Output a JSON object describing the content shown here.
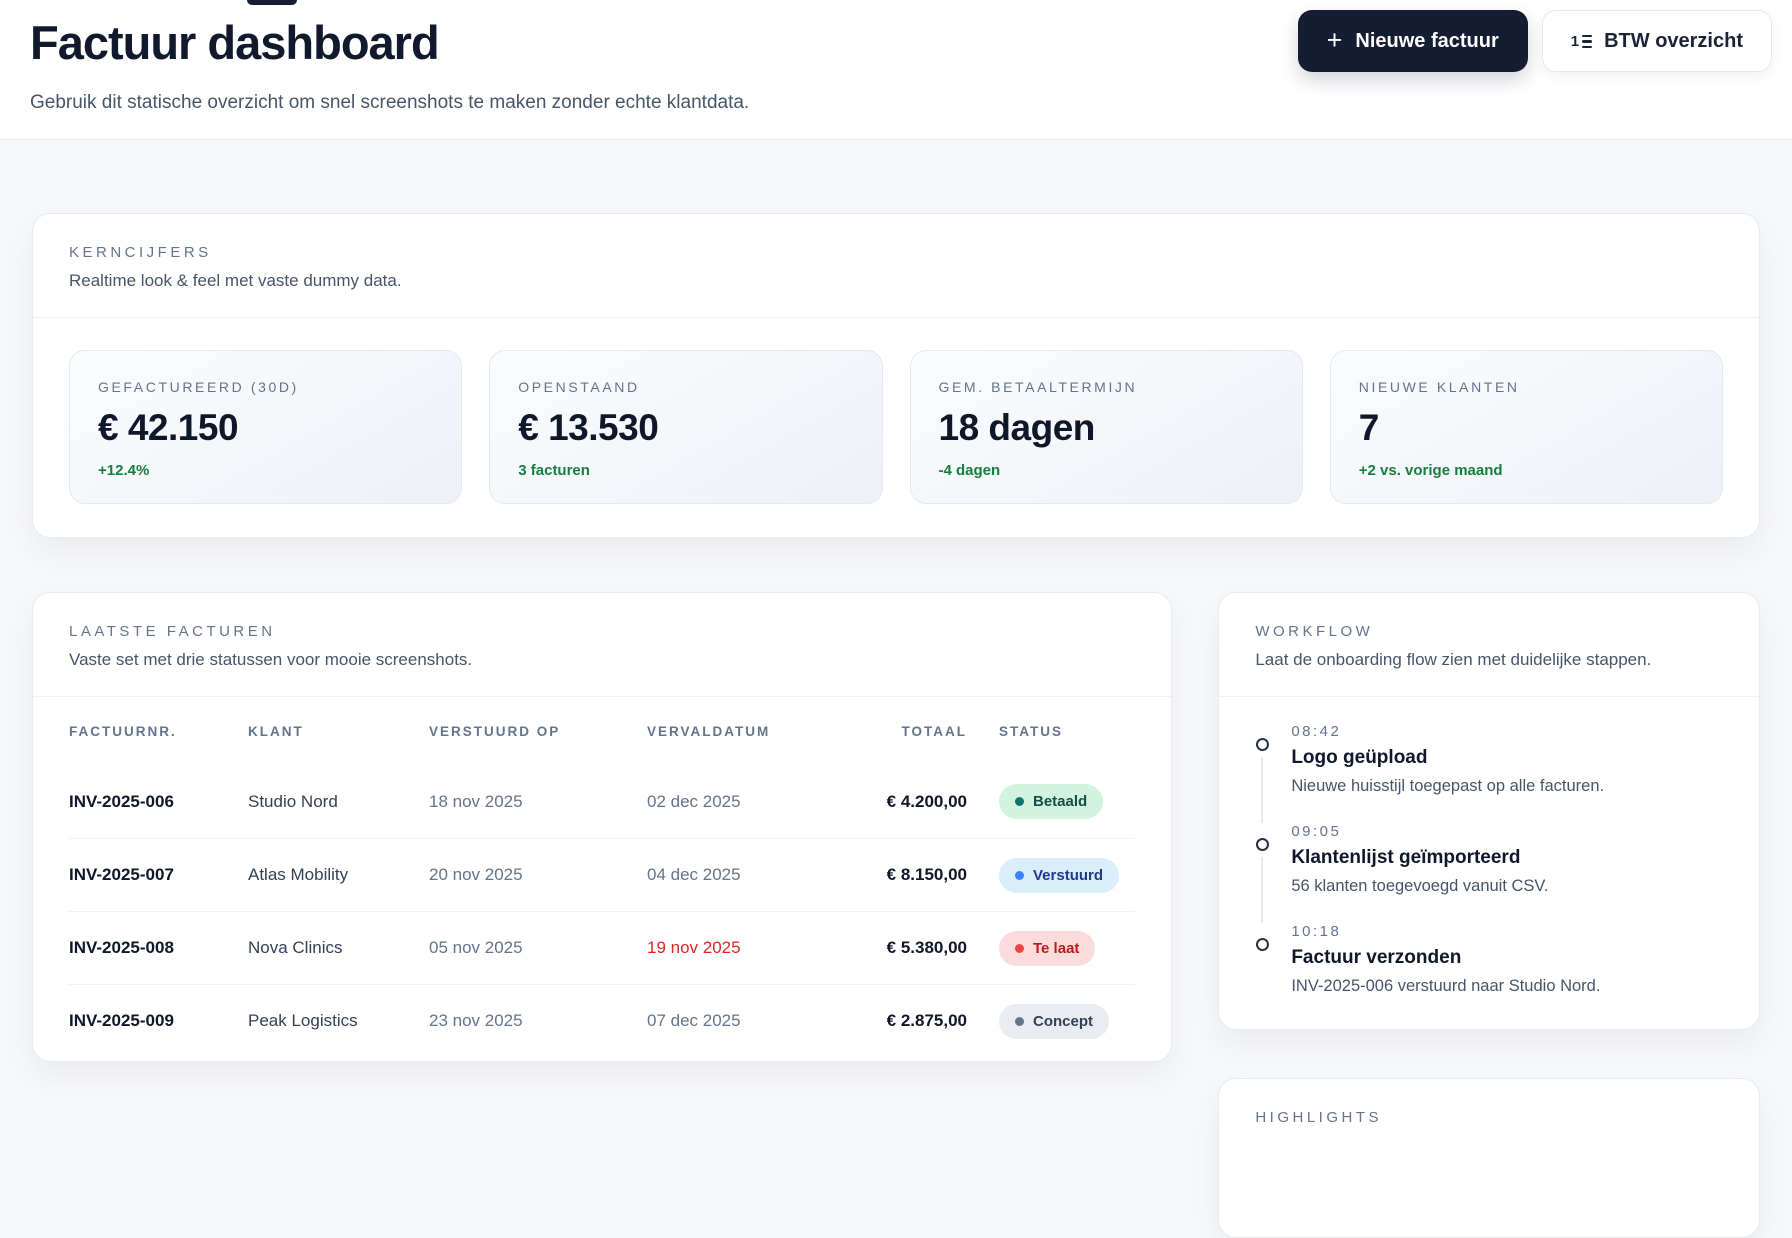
{
  "header": {
    "title": "Factuur dashboard",
    "subtitle": "Gebruik dit statische overzicht om snel screenshots te maken zonder echte klantdata.",
    "actions": {
      "new_invoice": {
        "label": "Nieuwe factuur",
        "icon_glyph": "+"
      },
      "btw_overview": {
        "label": "BTW overzicht",
        "icon_digit": "1"
      }
    }
  },
  "kpi": {
    "label": "KERNCIJFERS",
    "subtitle": "Realtime look & feel met vaste dummy data.",
    "cards": [
      {
        "label": "GEFACTUREERD (30D)",
        "value": "€ 42.150",
        "delta": "+12.4%"
      },
      {
        "label": "OPENSTAAND",
        "value": "€ 13.530",
        "delta": "3 facturen"
      },
      {
        "label": "GEM. BETAALTERMIJN",
        "value": "18 dagen",
        "delta": "-4 dagen"
      },
      {
        "label": "NIEUWE KLANTEN",
        "value": "7",
        "delta": "+2 vs. vorige maand"
      }
    ]
  },
  "invoices": {
    "label": "LAATSTE FACTUREN",
    "subtitle": "Vaste set met drie statussen voor mooie screenshots.",
    "columns": [
      "FACTUURNR.",
      "KLANT",
      "VERSTUURD OP",
      "VERVALDATUM",
      "TOTAAL",
      "STATUS"
    ],
    "rows": [
      {
        "nr": "INV-2025-006",
        "klant": "Studio Nord",
        "verstuurd": "18 nov 2025",
        "vervaldatum": "02 dec 2025",
        "totaal": "€ 4.200,00",
        "status": "Betaald"
      },
      {
        "nr": "INV-2025-007",
        "klant": "Atlas Mobility",
        "verstuurd": "20 nov 2025",
        "vervaldatum": "04 dec 2025",
        "totaal": "€ 8.150,00",
        "status": "Verstuurd"
      },
      {
        "nr": "INV-2025-008",
        "klant": "Nova Clinics",
        "verstuurd": "05 nov 2025",
        "vervaldatum": "19 nov 2025",
        "totaal": "€ 5.380,00",
        "status": "Te laat"
      },
      {
        "nr": "INV-2025-009",
        "klant": "Peak Logistics",
        "verstuurd": "23 nov 2025",
        "vervaldatum": "07 dec 2025",
        "totaal": "€ 2.875,00",
        "status": "Concept"
      }
    ]
  },
  "workflow": {
    "label": "WORKFLOW",
    "subtitle": "Laat de onboarding flow zien met duidelijke stappen.",
    "steps": [
      {
        "time": "08:42",
        "title": "Logo geüpload",
        "desc": "Nieuwe huisstijl toegepast op alle facturen."
      },
      {
        "time": "09:05",
        "title": "Klantenlijst geïmporteerd",
        "desc": "56 klanten toegevoegd vanuit CSV."
      },
      {
        "time": "10:18",
        "title": "Factuur verzonden",
        "desc": "INV-2025-006 verstuurd naar Studio Nord."
      }
    ]
  },
  "highlights": {
    "label": "HIGHLIGHTS"
  },
  "colors": {
    "accent_dark": "#141d31",
    "positive_green": "#15803d",
    "overdue_red": "#dc2626",
    "status_paid_bg": "#d3f3e1",
    "status_sent_bg": "#d9edfb",
    "status_late_bg": "#fbdbdb",
    "status_draft_bg": "#e9edf1"
  }
}
